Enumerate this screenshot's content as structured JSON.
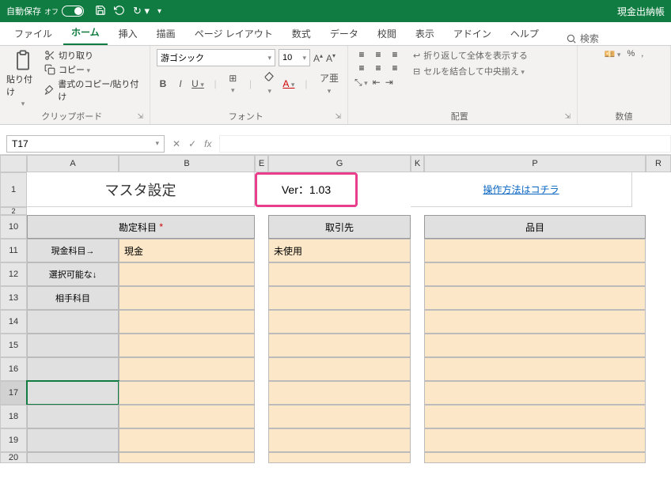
{
  "titlebar": {
    "autosave_label": "自動保存",
    "autosave_state": "オフ",
    "doc_title": "現金出納帳"
  },
  "menu": {
    "tabs": [
      "ファイル",
      "ホーム",
      "挿入",
      "描画",
      "ページ レイアウト",
      "数式",
      "データ",
      "校閲",
      "表示",
      "アドイン",
      "ヘルプ"
    ],
    "active_index": 1,
    "search_label": "検索"
  },
  "ribbon": {
    "clipboard": {
      "paste": "貼り付け",
      "cut": "切り取り",
      "copy": "コピー",
      "format_painter": "書式のコピー/貼り付け",
      "group_label": "クリップボード"
    },
    "font": {
      "family": "游ゴシック",
      "size": "10",
      "group_label": "フォント"
    },
    "align": {
      "wrap": "折り返して全体を表示する",
      "merge": "セルを結合して中央揃え",
      "group_label": "配置"
    },
    "number": {
      "group_label": "数値"
    }
  },
  "fbar": {
    "cell_ref": "T17",
    "formula": ""
  },
  "columns": [
    "A",
    "B",
    "E",
    "G",
    "K",
    "P",
    "R"
  ],
  "row_headers_start": [
    "1",
    "2",
    "10",
    "11",
    "12",
    "13",
    "14",
    "15",
    "16",
    "17",
    "18",
    "19",
    "20"
  ],
  "sheet": {
    "title": "マスタ設定",
    "version": "Ver：1.03",
    "help_link": "操作方法はコチラ",
    "headers": {
      "account": "勘定科目",
      "required_mark": "*",
      "partner": "取引先",
      "item": "品目"
    },
    "r11": {
      "label": "現金科目→",
      "value": "現金",
      "partner": "未使用"
    },
    "r12": {
      "label": "選択可能な↓"
    },
    "r13": {
      "label": "相手科目"
    }
  }
}
